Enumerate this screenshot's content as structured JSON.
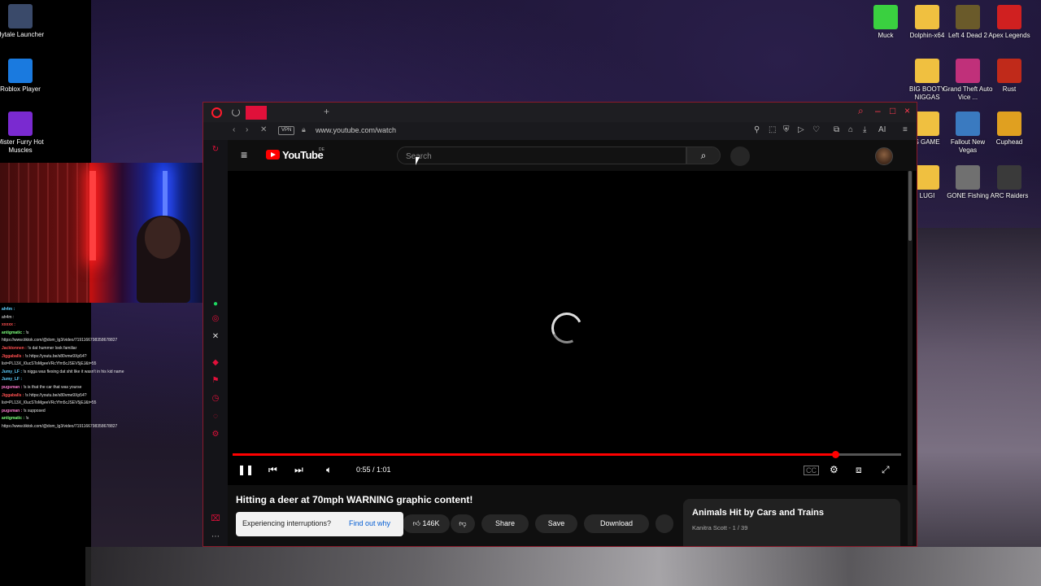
{
  "desktop": {
    "left_icons": [
      {
        "label": "Hytale Launcher",
        "icon": "hytale-icon",
        "color": "#3a4a6a"
      },
      {
        "label": "Roblox Player",
        "icon": "roblox-icon",
        "color": "#1a7adf"
      },
      {
        "label": "Mister Furry Hot Muscles",
        "icon": "mister-furry-icon",
        "color": "#7a2ad0"
      }
    ],
    "right_icons": [
      {
        "label": "Muck",
        "icon": "muck-icon",
        "color": "#3ad040"
      },
      {
        "label": "Dolphin-x64",
        "icon": "folder-icon",
        "color": "#f0c040"
      },
      {
        "label": "Left 4 Dead 2",
        "icon": "left4dead-icon",
        "color": "#6a5a2a"
      },
      {
        "label": "Apex Legends",
        "icon": "apex-icon",
        "color": "#d02020"
      },
      {
        "label": "BIG BOOTY NIGGAS",
        "icon": "folder-icon",
        "color": "#f0c040"
      },
      {
        "label": "Grand Theft Auto Vice ...",
        "icon": "gta-icon",
        "color": "#c0307a"
      },
      {
        "label": "Rust",
        "icon": "rust-icon",
        "color": "#c02a1a"
      },
      {
        "label": "S GAME",
        "icon": "folder-icon",
        "color": "#f0c040"
      },
      {
        "label": "Fallout New Vegas",
        "icon": "fallout-icon",
        "color": "#3a7ac0"
      },
      {
        "label": "Cuphead",
        "icon": "cuphead-icon",
        "color": "#e0a020"
      },
      {
        "label": "LUGI",
        "icon": "folder-icon",
        "color": "#f0c040"
      },
      {
        "label": "GONE Fishing",
        "icon": "gone-fishing-icon",
        "color": "#707070"
      },
      {
        "label": "ARC Raiders",
        "icon": "arc-raiders-icon",
        "color": "#3a3a3a"
      }
    ]
  },
  "chat": [
    {
      "user": "ah4m :",
      "text": "",
      "color": "#5fd0ff"
    },
    {
      "user": "",
      "text": "ah4m :",
      "color": "#ffffff"
    },
    {
      "user": "xxxxx :",
      "text": "",
      "color": "#ff5050"
    },
    {
      "user": "antigmatic :",
      "text": "!s",
      "color": "#7cff7c"
    },
    {
      "user": "",
      "text": "https://www.tiktok.com/@dom_lg3/video/7191166798358678827",
      "color": "#ffffff"
    },
    {
      "user": "Jacktonnen :",
      "text": "!s dat hummer look familiar",
      "color": "#ff5050"
    },
    {
      "user": "Jiggaballs :",
      "text": "!s https://youtu.be/s80vme9Xp54?",
      "color": "#ff5050"
    },
    {
      "user": "",
      "text": "list=PL13X_I0ucSToMgeeVRcYfm5cJSEV5jEJ&t=55",
      "color": "#ffffff"
    },
    {
      "user": "Jumy_LF :",
      "text": "!s nigga was flexing dat shit like it wasn't in his kid name",
      "color": "#5fd0ff"
    },
    {
      "user": "Jumy_LF :",
      "text": "",
      "color": "#5fd0ff"
    },
    {
      "user": "pugsman :",
      "text": "!s is that the car that was yourse",
      "color": "#ff7ad0"
    },
    {
      "user": "Jiggaballs :",
      "text": "!s https://youtu.be/s80vme9Xp54?",
      "color": "#ff5050"
    },
    {
      "user": "",
      "text": "list=PL13X_I0ucSToMgeeVRcYfm5cJSEV5jEJ&t=55",
      "color": "#ffffff"
    },
    {
      "user": "pugsman :",
      "text": "!s supposed",
      "color": "#ff7ad0"
    },
    {
      "user": "antigmatic :",
      "text": "!s",
      "color": "#7cff7c"
    },
    {
      "user": "",
      "text": "https://www.tiktok.com/@dom_lg3/video/7191166798358678827",
      "color": "#ffffff"
    }
  ],
  "browser": {
    "url": "www.youtube.com/watch",
    "vpn_label": "VPN",
    "ai_label": "AI"
  },
  "youtube": {
    "logo_text": "YouTube",
    "country_code": "DE",
    "search_placeholder": "Search",
    "video_title": "Hitting a deer at 70mph WARNING graphic content!",
    "time_display": "0:55 / 1:01",
    "progress_fraction": 0.902,
    "like_count": "146K",
    "share_label": "Share",
    "save_label": "Save",
    "download_label": "Download",
    "interrupt_text": "Experiencing interruptions?",
    "interrupt_link": "Find out why",
    "playlist_title": "Animals Hit by Cars and Trains",
    "playlist_sub": "Kanitra Scott - 1 / 39"
  },
  "colors": {
    "accent": "#ff0000",
    "opera": "#ff1b2d"
  }
}
